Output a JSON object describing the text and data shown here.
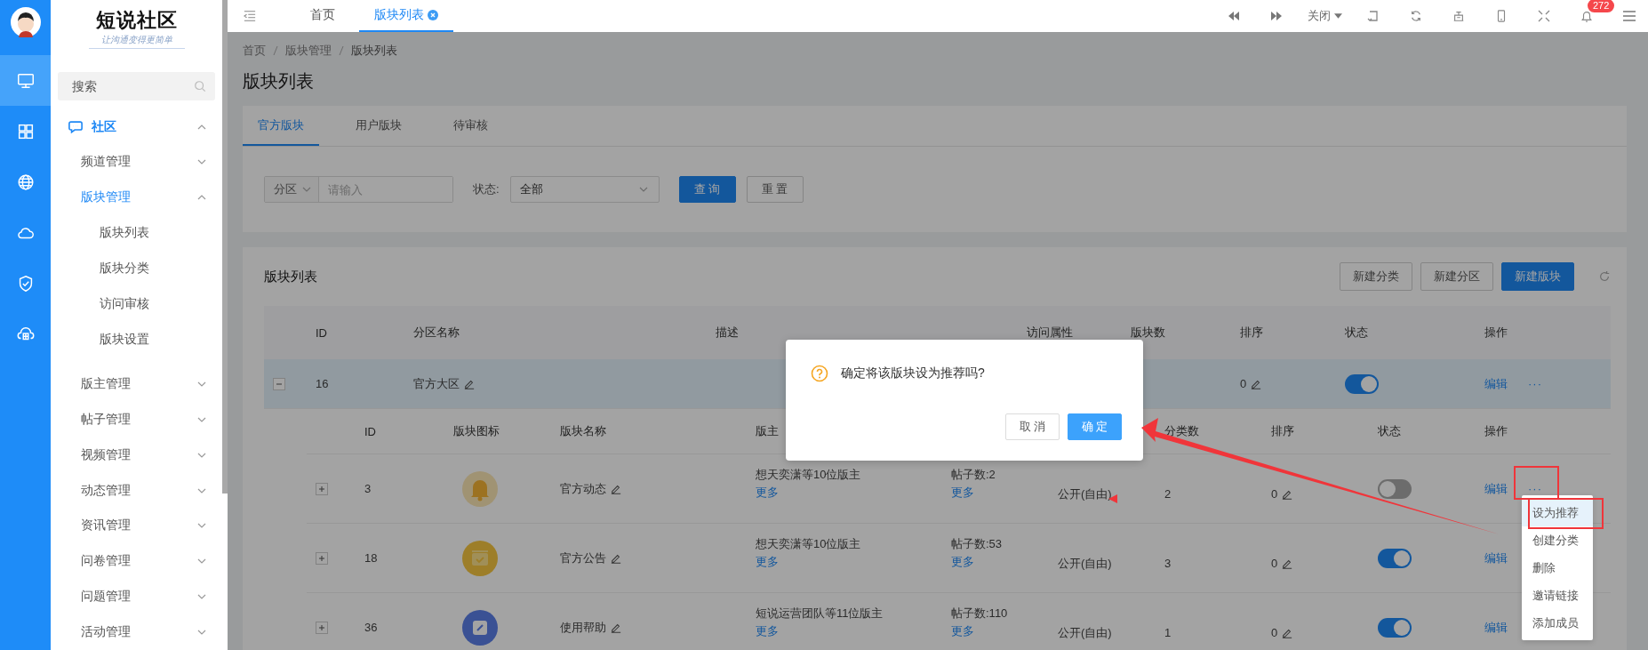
{
  "rail": {
    "items": [
      {
        "kind": "monitor",
        "selected": true
      },
      {
        "kind": "grid",
        "selected": false
      },
      {
        "kind": "globe",
        "selected": false
      },
      {
        "kind": "cloud",
        "selected": false
      },
      {
        "kind": "shield",
        "selected": false
      },
      {
        "kind": "cloud-box",
        "selected": false
      }
    ]
  },
  "brand": {
    "name": "短说社区",
    "slogan": "让沟通变得更简单"
  },
  "sidebar": {
    "search": {
      "placeholder": "搜索"
    },
    "menu": [
      {
        "label": "社区",
        "expanded": true,
        "selected": true,
        "children": [
          {
            "label": "频道管理",
            "expanded": false,
            "selected": false
          },
          {
            "label": "版块管理",
            "expanded": true,
            "selected": true,
            "children": [
              {
                "label": "版块列表",
                "selected": false
              },
              {
                "label": "版块分类",
                "selected": false
              },
              {
                "label": "访问审核",
                "selected": false
              },
              {
                "label": "版块设置",
                "selected": false
              }
            ]
          },
          {
            "label": "版主管理",
            "expanded": false,
            "selected": false
          },
          {
            "label": "帖子管理",
            "expanded": false,
            "selected": false
          },
          {
            "label": "视频管理",
            "expanded": false,
            "selected": false
          },
          {
            "label": "动态管理",
            "expanded": false,
            "selected": false
          },
          {
            "label": "资讯管理",
            "expanded": false,
            "selected": false
          },
          {
            "label": "问卷管理",
            "expanded": false,
            "selected": false
          },
          {
            "label": "问题管理",
            "expanded": false,
            "selected": false
          },
          {
            "label": "活动管理",
            "expanded": false,
            "selected": false
          }
        ]
      }
    ]
  },
  "topbar": {
    "tabs": [
      {
        "label": "首页",
        "selected": false,
        "closable": false
      },
      {
        "label": "版块列表",
        "selected": true,
        "closable": true
      }
    ],
    "close_menu": "关闭",
    "notification_count": "272"
  },
  "breadcrumb": [
    "首页",
    "版块管理",
    "版块列表"
  ],
  "page_title": "版块列表",
  "content_tabs": [
    {
      "label": "官方版块",
      "selected": true
    },
    {
      "label": "用户版块",
      "selected": false
    },
    {
      "label": "待审核",
      "selected": false
    }
  ],
  "filter": {
    "zone_select": "分区",
    "keyword": {
      "placeholder": "请输入"
    },
    "status_label": "状态:",
    "status_select": "全部",
    "search_button": "查 询",
    "reset_button": "重 置"
  },
  "board_list": {
    "title": "版块列表",
    "buttons": [
      {
        "label": "新建分类",
        "primary": false
      },
      {
        "label": "新建分区",
        "primary": false
      },
      {
        "label": "新建版块",
        "primary": true
      }
    ],
    "table": {
      "columns": [
        "ID",
        "分区名称",
        "描述",
        "访问属性",
        "版块数",
        "排序",
        "状态",
        "操作"
      ],
      "group_rows": [
        {
          "expanded": true,
          "selected": true,
          "id": "16",
          "name": "官方大区",
          "sort": "0",
          "on": true,
          "edit": "编辑",
          "more": "···"
        }
      ],
      "sub_columns": {
        "id": "ID",
        "icon": "版块图标",
        "name": "版块名称",
        "moderators": "版主",
        "categories": "分类数",
        "sort": "排序",
        "status": "状态",
        "actions": "操作"
      },
      "sub_rows": [
        {
          "expanded": false,
          "id": "3",
          "kind": "bell",
          "name": "官方动态",
          "moderators": "想天奕潇等10位版主",
          "moderators_more": "更多",
          "posts": "帖子数:2",
          "posts_more": "更多",
          "access": "公开(自由)",
          "categories": "2",
          "sort": "0",
          "on": false,
          "edit": "编辑",
          "more": "···"
        },
        {
          "expanded": false,
          "id": "18",
          "kind": "inbox",
          "name": "官方公告",
          "moderators": "想天奕潇等10位版主",
          "moderators_more": "更多",
          "posts": "帖子数:53",
          "posts_more": "更多",
          "access": "公开(自由)",
          "categories": "3",
          "sort": "0",
          "on": true,
          "edit": "编辑"
        },
        {
          "expanded": false,
          "id": "36",
          "kind": "pencil",
          "name": "使用帮助",
          "moderators": "短说运营团队等11位版主",
          "moderators_more": "更多",
          "posts": "帖子数:110",
          "posts_more": "更多",
          "access": "公开(自由)",
          "categories": "1",
          "sort": "0",
          "on": true,
          "edit": "编辑"
        }
      ]
    }
  },
  "dropdown": {
    "items": [
      {
        "label": "设为推荐",
        "selected": true
      },
      {
        "label": "创建分类",
        "selected": false
      },
      {
        "label": "删除",
        "selected": false
      },
      {
        "label": "邀请链接",
        "selected": false
      },
      {
        "label": "添加成员",
        "selected": false
      }
    ]
  },
  "modal": {
    "message": "确定将该版块设为推荐吗?",
    "cancel": "取 消",
    "confirm": "确 定"
  }
}
